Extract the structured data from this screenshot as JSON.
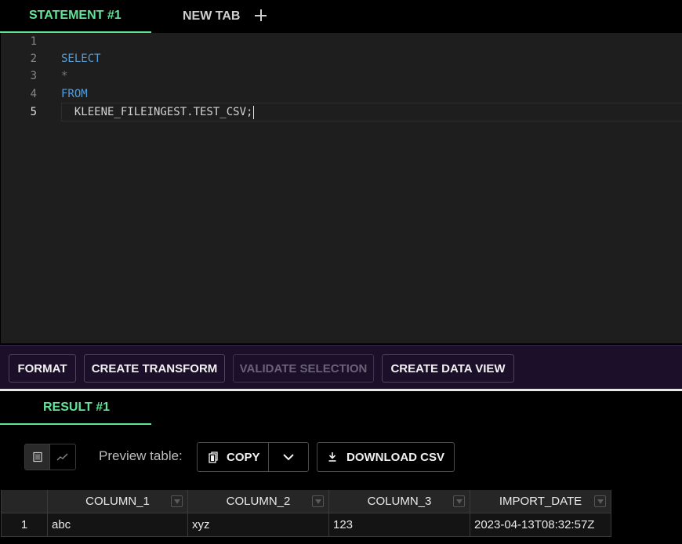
{
  "tabs": {
    "active_label": "STATEMENT #1",
    "new_tab_label": "NEW TAB"
  },
  "editor": {
    "line_numbers": [
      "1",
      "2",
      "3",
      "4",
      "5"
    ],
    "lines": {
      "l2": "SELECT",
      "l3": "*",
      "l4": "FROM",
      "l5": "  KLEENE_FILEINGEST.TEST_CSV;"
    }
  },
  "toolbar": {
    "format_label": "FORMAT",
    "create_transform_label": "CREATE TRANSFORM",
    "validate_selection_label": "VALIDATE SELECTION",
    "create_data_view_label": "CREATE DATA VIEW"
  },
  "results": {
    "tab_label": "RESULT #1",
    "preview_label": "Preview table:",
    "copy_label": "COPY",
    "download_label": "DOWNLOAD CSV",
    "columns": [
      "COLUMN_1",
      "COLUMN_2",
      "COLUMN_3",
      "IMPORT_DATE"
    ],
    "rows": [
      {
        "index": "1",
        "cells": [
          "abc",
          "xyz",
          "123",
          "2023-04-13T08:32:57Z"
        ]
      }
    ]
  },
  "colors": {
    "accent": "#62e39a",
    "keyword": "#569cd6",
    "toolbar_bg": "#1b0f2a"
  },
  "icons": {
    "add_tab": "plus-icon",
    "table_view": "table-icon",
    "chart_view": "chart-icon",
    "copy": "copy-icon",
    "dropdown": "chevron-down-icon",
    "download": "download-icon",
    "filter": "filter-icon"
  }
}
